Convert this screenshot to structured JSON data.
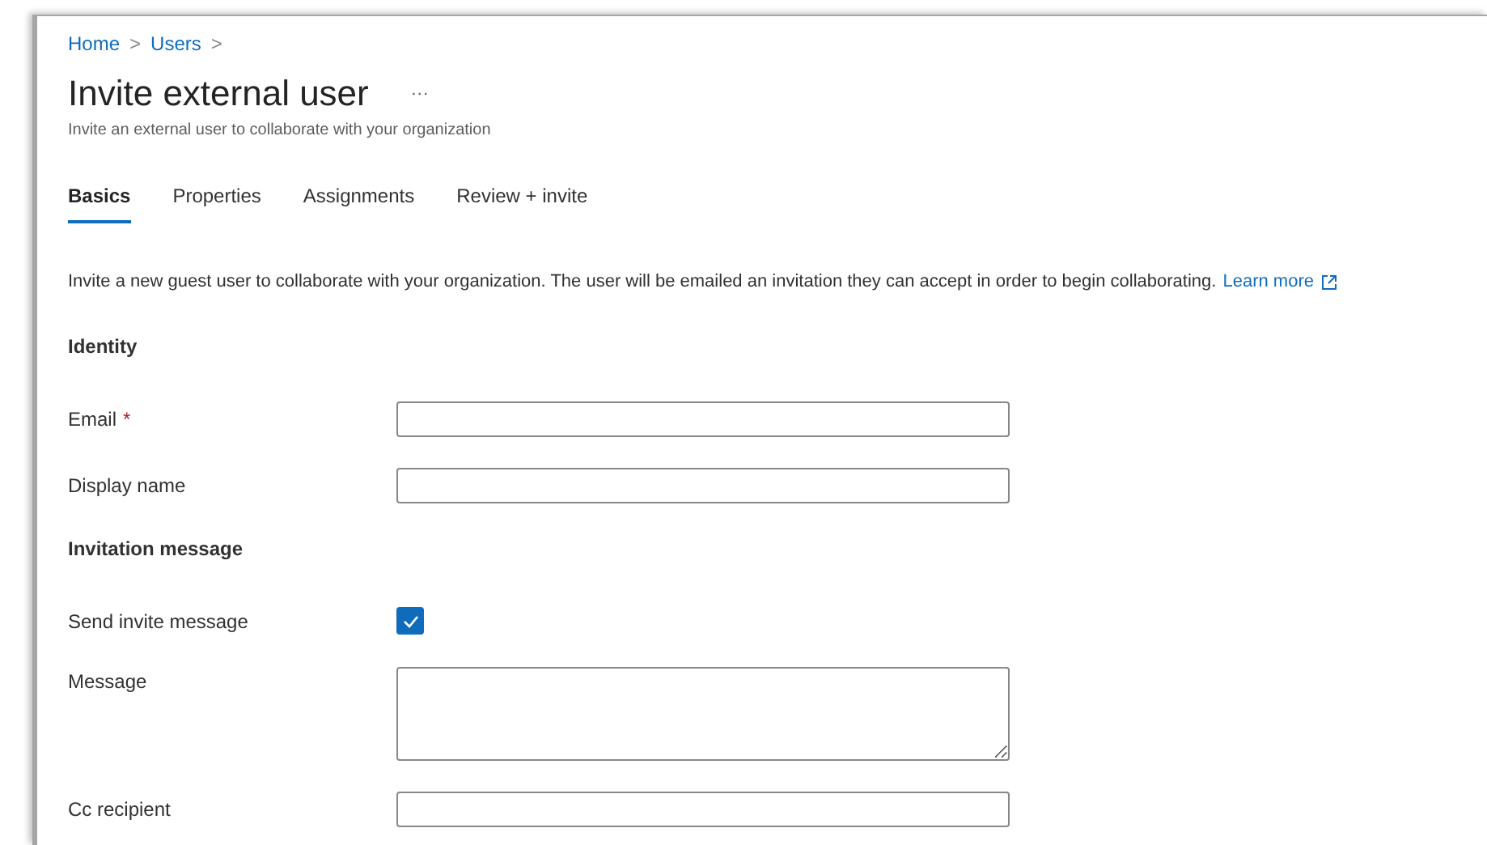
{
  "breadcrumb": [
    {
      "label": "Home",
      "separator": ">"
    },
    {
      "label": "Users",
      "separator": ">"
    }
  ],
  "title": "Invite external user",
  "more": "···",
  "subtitle": "Invite an external user to collaborate with your organization",
  "tabs": [
    {
      "label": "Basics",
      "selected": true
    },
    {
      "label": "Properties",
      "selected": false
    },
    {
      "label": "Assignments",
      "selected": false
    },
    {
      "label": "Review + invite",
      "selected": false
    }
  ],
  "intro": {
    "text": "Invite a new guest user to collaborate with your organization. The user will be emailed an invitation they can accept in order to begin collaborating.",
    "link": "Learn more"
  },
  "sections": [
    {
      "heading": "Identity",
      "fields": [
        {
          "kind": "text",
          "label": "Email",
          "required_mark": "*"
        },
        {
          "kind": "text",
          "label": "Display name"
        }
      ]
    },
    {
      "heading": "Invitation message",
      "fields": [
        {
          "kind": "checkbox",
          "label": "Send invite message",
          "checked": true
        },
        {
          "kind": "textarea",
          "label": "Message"
        },
        {
          "kind": "text",
          "label": "Cc recipient"
        }
      ]
    }
  ]
}
